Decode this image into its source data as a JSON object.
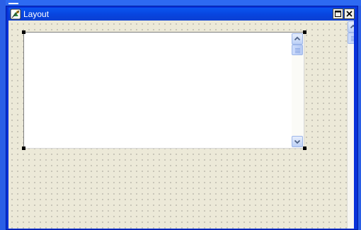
{
  "window": {
    "title": "Layout",
    "controls": [
      "restore",
      "close"
    ]
  },
  "canvas": {
    "grid": "dotted",
    "background": "#ece9d8"
  },
  "design_control": {
    "type": "memo",
    "selected": true,
    "has_vertical_scrollbar": true
  },
  "colors": {
    "titlebar": "#0845e0",
    "title_text": "#ffffff",
    "scrollbar_accent": "#bcd0f6",
    "selection_handle": "#000000"
  },
  "icons": {
    "app": "layout-app-icon",
    "restore": "restore-icon",
    "close": "close-icon",
    "scroll_up": "chevron-up-icon",
    "scroll_down": "chevron-down-icon"
  }
}
